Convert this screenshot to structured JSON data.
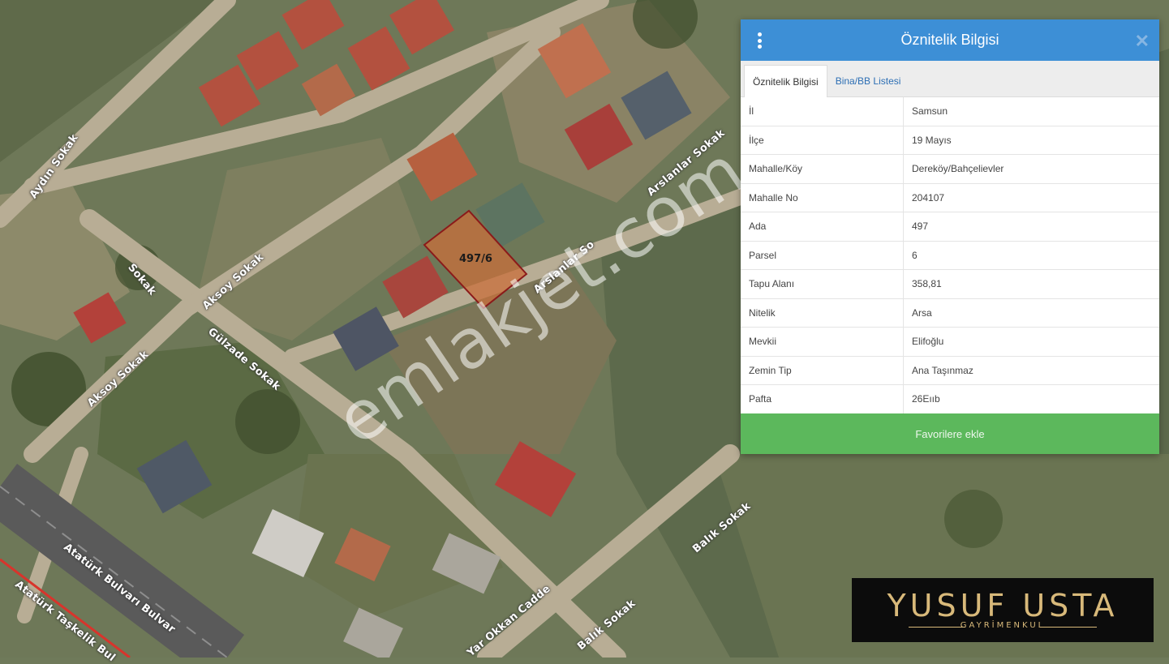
{
  "map": {
    "parcel_label": "497/6",
    "streets": [
      {
        "name": "Aydın Sokak"
      },
      {
        "name": "Aksoy Sokak"
      },
      {
        "name": "Sokak"
      },
      {
        "name": "Aksoy Sokak"
      },
      {
        "name": "Gülzade Sokak"
      },
      {
        "name": "Arslanlar Sokak"
      },
      {
        "name": "Arslanlar So"
      },
      {
        "name": "Atatürk Bulvarı Bulvar"
      },
      {
        "name": "Atatürk Taşkelik Bul"
      },
      {
        "name": "Yar Okkan Cadde"
      },
      {
        "name": "Balık Sokak"
      },
      {
        "name": "Balık Sokak"
      }
    ],
    "watermark": "emlakjet.com"
  },
  "panel": {
    "title": "Öznitelik Bilgisi",
    "tabs": [
      {
        "label": "Öznitelik Bilgisi",
        "active": true
      },
      {
        "label": "Bina/BB Listesi",
        "active": false
      }
    ],
    "rows": [
      {
        "key": "İl",
        "value": "Samsun"
      },
      {
        "key": "İlçe",
        "value": "19 Mayıs"
      },
      {
        "key": "Mahalle/Köy",
        "value": "Dereköy/Bahçelievler"
      },
      {
        "key": "Mahalle No",
        "value": "204107"
      },
      {
        "key": "Ada",
        "value": "497"
      },
      {
        "key": "Parsel",
        "value": "6"
      },
      {
        "key": "Tapu Alanı",
        "value": "358,81"
      },
      {
        "key": "Nitelik",
        "value": "Arsa"
      },
      {
        "key": "Mevkii",
        "value": "Elifoğlu"
      },
      {
        "key": "Zemin Tip",
        "value": "Ana Taşınmaz"
      },
      {
        "key": "Pafta",
        "value": "26Eııb"
      }
    ],
    "favorite_button": "Favorilere ekle"
  },
  "logo": {
    "main": "YUSUF USTA",
    "sub": "GAYRİMENKUL"
  },
  "colors": {
    "header": "#3d8fd6",
    "favorite": "#5cb85c",
    "parcel_outline": "#8b1a1a",
    "logo_gold": "#d8b97a"
  }
}
